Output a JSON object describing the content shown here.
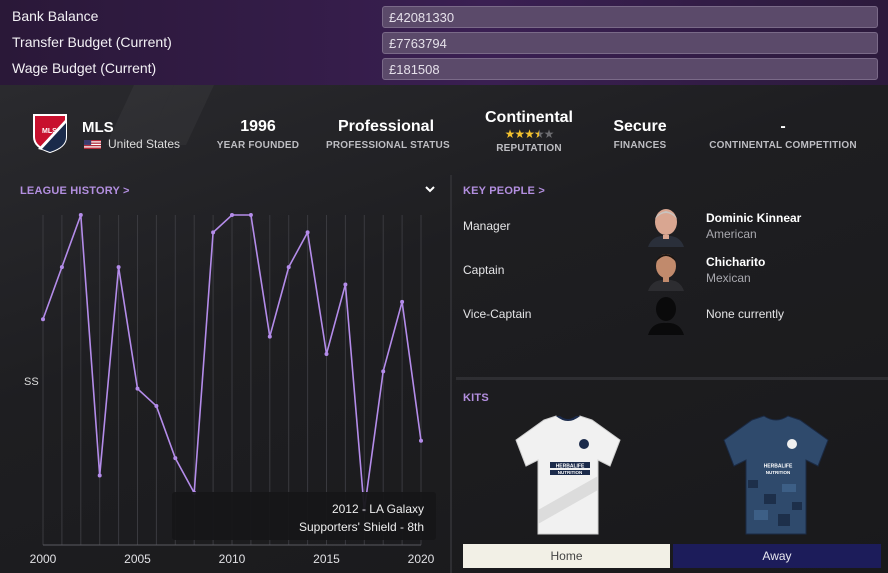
{
  "finances": {
    "bank_balance": {
      "label": "Bank Balance",
      "value": "£42081330"
    },
    "transfer_budget": {
      "label": "Transfer Budget (Current)",
      "value": "£7763794"
    },
    "wage_budget": {
      "label": "Wage Budget (Current)",
      "value": "£181508"
    }
  },
  "club_info": {
    "league": "MLS",
    "country": "United States",
    "year_founded": {
      "value": "1996",
      "label": "YEAR FOUNDED"
    },
    "professional_status": {
      "value": "Professional",
      "label": "PROFESSIONAL STATUS"
    },
    "reputation": {
      "value": "Continental",
      "label": "REPUTATION",
      "stars": 3.5,
      "max_stars": 5
    },
    "finances": {
      "value": "Secure",
      "label": "FINANCES"
    },
    "continental_competition": {
      "value": "-",
      "label": "CONTINENTAL COMPETITION"
    }
  },
  "league_history": {
    "title": "LEAGUE HISTORY",
    "title_chevron": ">",
    "dropdown_icon": "chevron-down-icon",
    "tooltip": {
      "line1": "2012 - LA Galaxy",
      "line2": "Supporters' Shield - 8th"
    }
  },
  "chart_data": {
    "type": "line",
    "xlabel": "",
    "ylabel": "SS",
    "x_ticks": [
      2000,
      2005,
      2010,
      2015,
      2020
    ],
    "xlim": [
      2000,
      2020
    ],
    "ylim": [
      1,
      20
    ],
    "y_axis_inverted": true,
    "grid": "vertical lines per season",
    "line_color": "#b48cea",
    "series": [
      {
        "x": [
          2000,
          2001,
          2002,
          2003,
          2004,
          2005,
          2006,
          2007,
          2008,
          2009,
          2010,
          2011,
          2012,
          2013,
          2014,
          2015,
          2016,
          2017,
          2018,
          2019,
          2020
        ],
        "y": [
          7,
          4,
          1,
          16,
          4,
          11,
          12,
          15,
          17,
          2,
          1,
          1,
          8,
          4,
          2,
          9,
          5,
          18,
          10,
          6,
          14
        ]
      }
    ]
  },
  "key_people": {
    "title": "KEY PEOPLE",
    "title_chevron": ">",
    "people": [
      {
        "role": "Manager",
        "name": "Dominic Kinnear",
        "nationality": "American"
      },
      {
        "role": "Captain",
        "name": "Chicharito",
        "nationality": "Mexican"
      },
      {
        "role": "Vice-Captain",
        "none_text": "None currently"
      }
    ]
  },
  "kits": {
    "title": "KITS",
    "home": {
      "label": "Home",
      "sponsor": "HERBALIFE NUTRITION",
      "color": "#f1f1f1"
    },
    "away": {
      "label": "Away",
      "sponsor": "HERBALIFE NUTRITION",
      "color": "#2f4a6c"
    }
  },
  "colors": {
    "accent": "#b38fe0",
    "finance_bg": "#3a1f52",
    "home_button": "#f2f0e6",
    "away_button": "#1c1c5a"
  }
}
